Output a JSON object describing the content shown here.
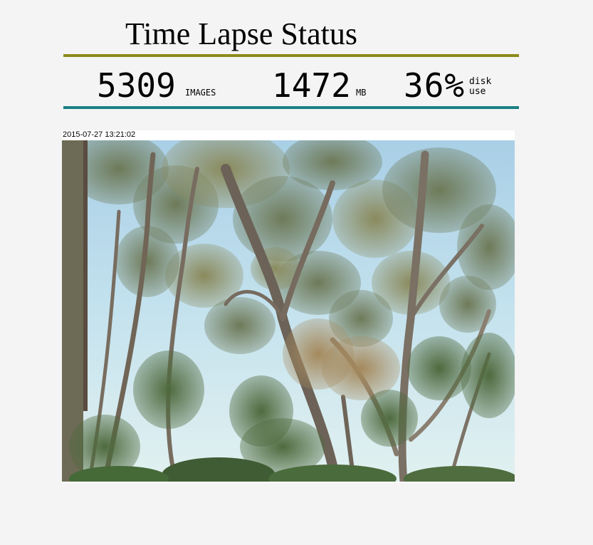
{
  "header": {
    "title": "Time Lapse Status",
    "accent_color": "#8a8a18",
    "stats_rule_color": "#1a7f85"
  },
  "stats": {
    "images": {
      "value": "5309",
      "unit": "IMAGES"
    },
    "size": {
      "value": "1472",
      "unit": "MB"
    },
    "disk": {
      "value": "36%",
      "unit_line1": "disk",
      "unit_line2": "use"
    }
  },
  "latest_image": {
    "timestamp": "2015-07-27 13:21:02",
    "subject": "eucalyptus-trees-sky-photo"
  }
}
